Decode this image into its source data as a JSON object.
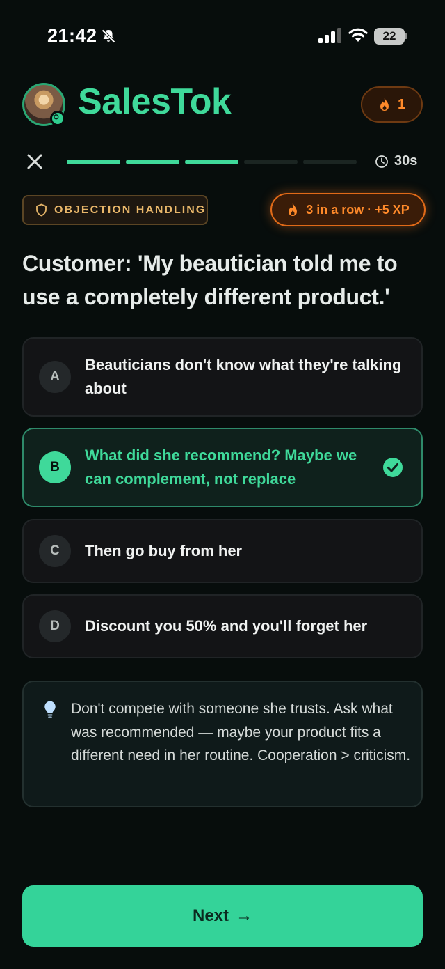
{
  "status_bar": {
    "time": "21:42",
    "battery": "22"
  },
  "header": {
    "app_title": "SalesTok",
    "streak_count": "1"
  },
  "progress": {
    "segments_total": 5,
    "segments_done": 3,
    "timer": "30s"
  },
  "tags": {
    "category": "OBJECTION HANDLING",
    "combo": "3 in a row · +5 XP"
  },
  "question": "Customer: 'My beautician told me to use a completely different product.'",
  "options": [
    {
      "letter": "A",
      "text": "Beauticians don't know what they're talking about",
      "selected": false
    },
    {
      "letter": "B",
      "text": "What did she recommend? Maybe we can complement, not replace",
      "selected": true
    },
    {
      "letter": "C",
      "text": "Then go buy from her",
      "selected": false
    },
    {
      "letter": "D",
      "text": "Discount you 50% and you'll forget her",
      "selected": false
    }
  ],
  "explanation": "Don't compete with someone she trusts. Ask what was recommended — maybe your product fits a different need in her routine. Cooperation > criticism.",
  "next_button": {
    "label": "Next",
    "arrow": "→"
  },
  "colors": {
    "accent": "#3fd99a",
    "streak": "#ff8a2a",
    "tag": "#e8b76a",
    "background": "#070d0c"
  },
  "icons": [
    "bell-muted-icon",
    "signal-icon",
    "wifi-icon",
    "battery-icon",
    "flame-icon",
    "close-icon",
    "clock-icon",
    "shield-icon",
    "check-icon",
    "lightbulb-icon"
  ]
}
